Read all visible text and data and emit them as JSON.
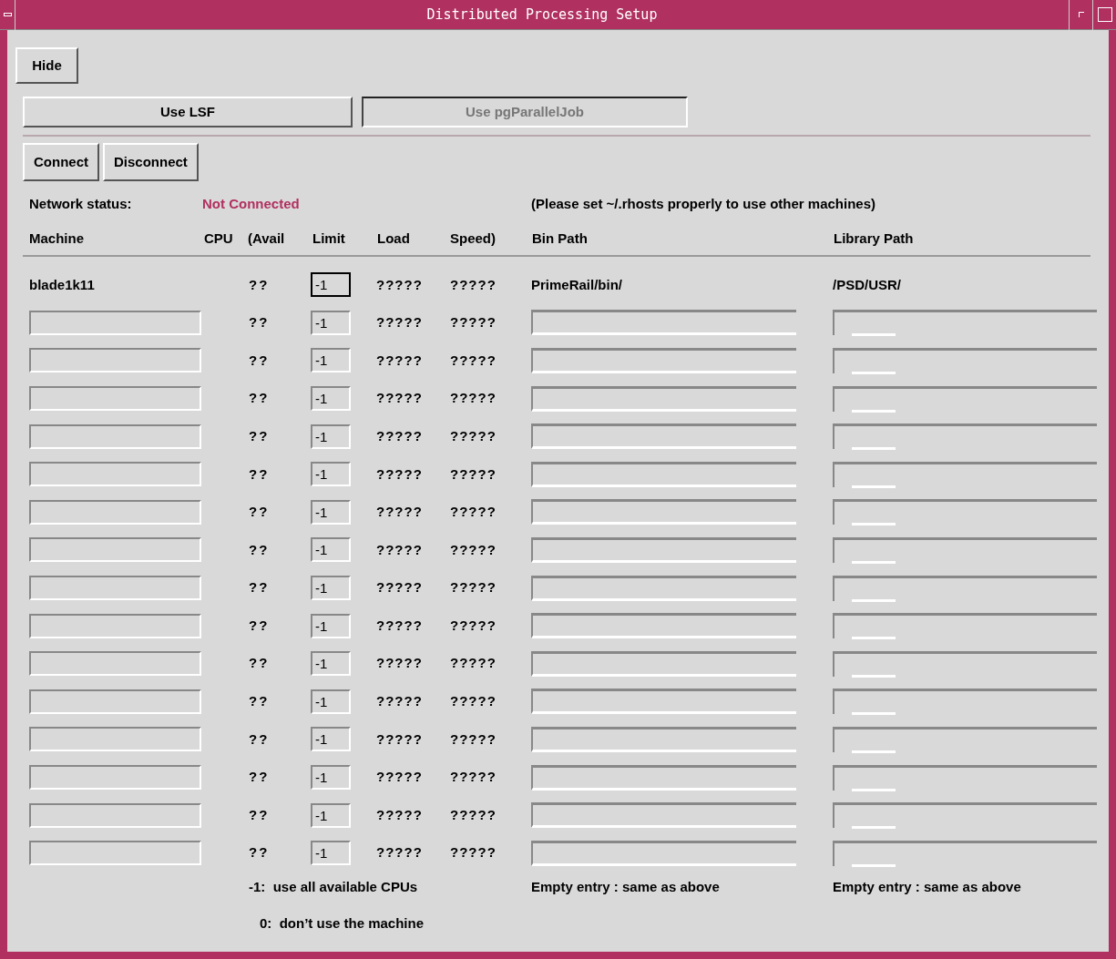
{
  "window": {
    "title": "Distributed Processing Setup"
  },
  "hide_button": "Hide",
  "modes": [
    {
      "label": "Use LSF",
      "selected": true
    },
    {
      "label": "Use pgParallelJob",
      "selected": false
    }
  ],
  "connection_buttons": [
    "Connect",
    "Disconnect"
  ],
  "network_status": {
    "label": "Network status:",
    "value": "Not Connected"
  },
  "hint": "(Please set ~/.rhosts properly to use other machines)",
  "columns": [
    "Machine",
    "CPU",
    "(Avail",
    "Limit",
    "Load",
    "Speed)",
    "Bin Path",
    "Library Path"
  ],
  "rows": [
    {
      "kind": "fixed",
      "machine": "blade1k11",
      "avail": "??",
      "limit": "-1",
      "limit_focused": true,
      "load": "?????",
      "speed": "?????",
      "bin_path": "PrimeRail/bin/",
      "library_path": "/PSD/USR/"
    },
    {
      "kind": "entry",
      "avail": "??",
      "limit": "-1",
      "limit_focused": false,
      "load": "?????",
      "speed": "?????"
    },
    {
      "kind": "entry",
      "avail": "??",
      "limit": "-1",
      "limit_focused": false,
      "load": "?????",
      "speed": "?????"
    },
    {
      "kind": "entry",
      "avail": "??",
      "limit": "-1",
      "limit_focused": false,
      "load": "?????",
      "speed": "?????"
    },
    {
      "kind": "entry",
      "avail": "??",
      "limit": "-1",
      "limit_focused": false,
      "load": "?????",
      "speed": "?????"
    },
    {
      "kind": "entry",
      "avail": "??",
      "limit": "-1",
      "limit_focused": false,
      "load": "?????",
      "speed": "?????"
    },
    {
      "kind": "entry",
      "avail": "??",
      "limit": "-1",
      "limit_focused": false,
      "load": "?????",
      "speed": "?????"
    },
    {
      "kind": "entry",
      "avail": "??",
      "limit": "-1",
      "limit_focused": false,
      "load": "?????",
      "speed": "?????"
    },
    {
      "kind": "entry",
      "avail": "??",
      "limit": "-1",
      "limit_focused": false,
      "load": "?????",
      "speed": "?????"
    },
    {
      "kind": "entry",
      "avail": "??",
      "limit": "-1",
      "limit_focused": false,
      "load": "?????",
      "speed": "?????"
    },
    {
      "kind": "entry",
      "avail": "??",
      "limit": "-1",
      "limit_focused": false,
      "load": "?????",
      "speed": "?????"
    },
    {
      "kind": "entry",
      "avail": "??",
      "limit": "-1",
      "limit_focused": false,
      "load": "?????",
      "speed": "?????"
    },
    {
      "kind": "entry",
      "avail": "??",
      "limit": "-1",
      "limit_focused": false,
      "load": "?????",
      "speed": "?????"
    },
    {
      "kind": "entry",
      "avail": "??",
      "limit": "-1",
      "limit_focused": false,
      "load": "?????",
      "speed": "?????"
    },
    {
      "kind": "entry",
      "avail": "??",
      "limit": "-1",
      "limit_focused": false,
      "load": "?????",
      "speed": "?????"
    },
    {
      "kind": "entry",
      "avail": "??",
      "limit": "-1",
      "limit_focused": false,
      "load": "?????",
      "speed": "?????"
    }
  ],
  "notes": {
    "limit": [
      "-1:  use all available CPUs",
      "0:  don’t use the machine"
    ],
    "bin_path": "Empty entry : same as above",
    "library_path": "Empty entry : same as above"
  }
}
